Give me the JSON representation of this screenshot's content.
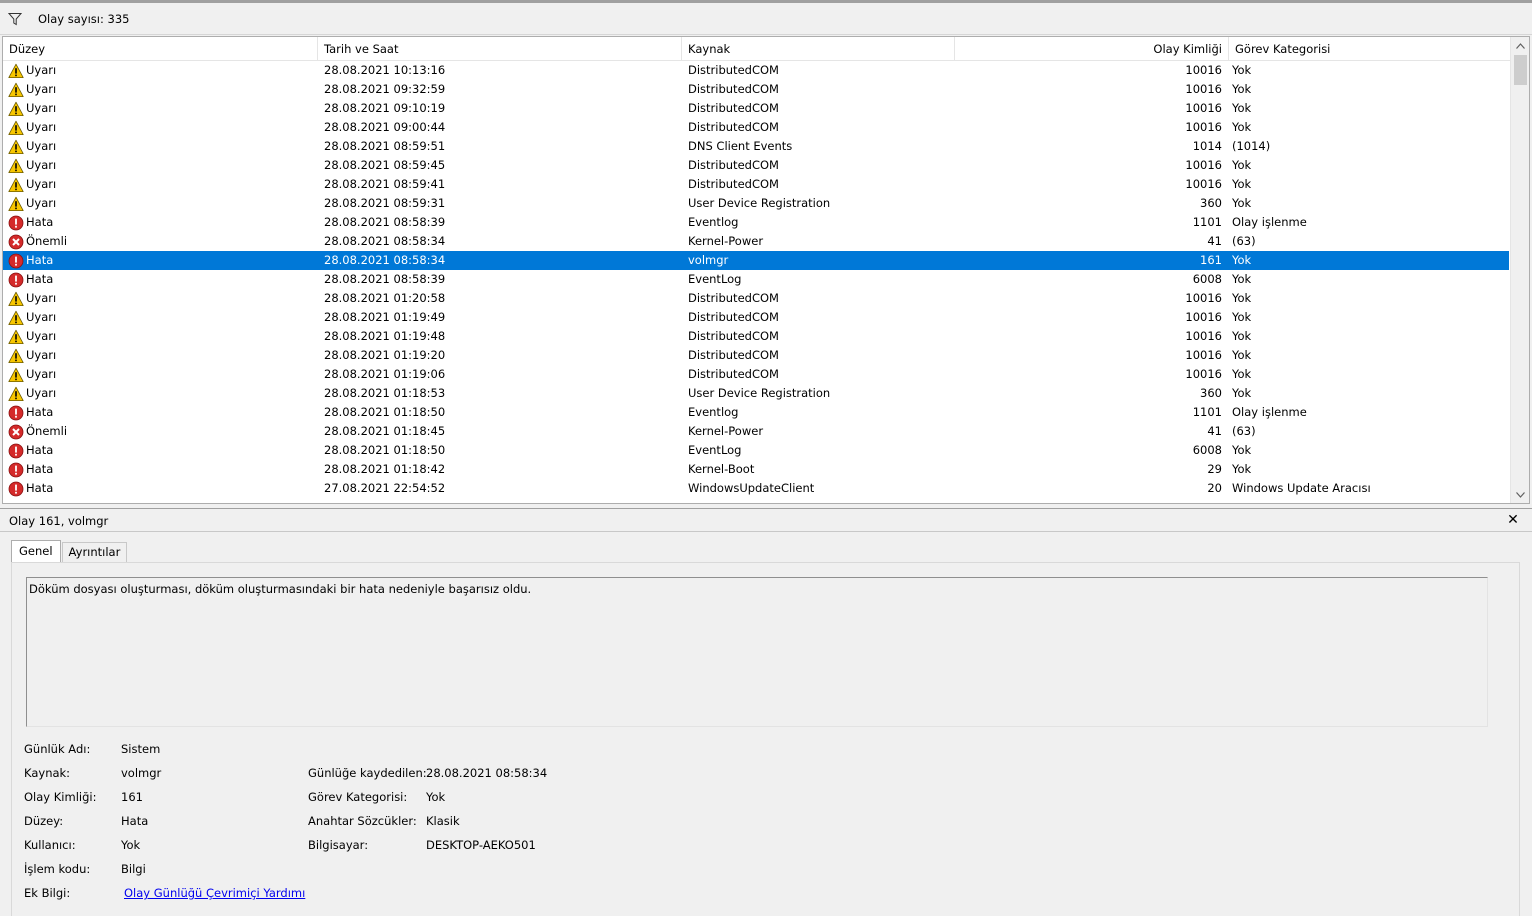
{
  "toolbar": {
    "filter_icon": "filter-funnel-icon",
    "event_count": "Olay sayısı: 335"
  },
  "columns": {
    "level": "Düzey",
    "date": "Tarih ve Saat",
    "source": "Kaynak",
    "id": "Olay Kimliği",
    "task": "Görev Kategorisi"
  },
  "level_colors": {
    "warning": "#f5c400",
    "error": "#cc1f1f",
    "critical": "#cc1f1f",
    "selected_bg": "#0078d7"
  },
  "events": [
    {
      "type": "warning",
      "level": "Uyarı",
      "date": "28.08.2021 10:13:16",
      "source": "DistributedCOM",
      "id": "10016",
      "task": "Yok"
    },
    {
      "type": "warning",
      "level": "Uyarı",
      "date": "28.08.2021 09:32:59",
      "source": "DistributedCOM",
      "id": "10016",
      "task": "Yok"
    },
    {
      "type": "warning",
      "level": "Uyarı",
      "date": "28.08.2021 09:10:19",
      "source": "DistributedCOM",
      "id": "10016",
      "task": "Yok"
    },
    {
      "type": "warning",
      "level": "Uyarı",
      "date": "28.08.2021 09:00:44",
      "source": "DistributedCOM",
      "id": "10016",
      "task": "Yok"
    },
    {
      "type": "warning",
      "level": "Uyarı",
      "date": "28.08.2021 08:59:51",
      "source": "DNS Client Events",
      "id": "1014",
      "task": "(1014)"
    },
    {
      "type": "warning",
      "level": "Uyarı",
      "date": "28.08.2021 08:59:45",
      "source": "DistributedCOM",
      "id": "10016",
      "task": "Yok"
    },
    {
      "type": "warning",
      "level": "Uyarı",
      "date": "28.08.2021 08:59:41",
      "source": "DistributedCOM",
      "id": "10016",
      "task": "Yok"
    },
    {
      "type": "warning",
      "level": "Uyarı",
      "date": "28.08.2021 08:59:31",
      "source": "User Device Registration",
      "id": "360",
      "task": "Yok"
    },
    {
      "type": "error",
      "level": "Hata",
      "date": "28.08.2021 08:58:39",
      "source": "Eventlog",
      "id": "1101",
      "task": "Olay işlenme"
    },
    {
      "type": "critical",
      "level": "Önemli",
      "date": "28.08.2021 08:58:34",
      "source": "Kernel-Power",
      "id": "41",
      "task": "(63)"
    },
    {
      "type": "error",
      "level": "Hata",
      "date": "28.08.2021 08:58:34",
      "source": "volmgr",
      "id": "161",
      "task": "Yok",
      "selected": true
    },
    {
      "type": "error",
      "level": "Hata",
      "date": "28.08.2021 08:58:39",
      "source": "EventLog",
      "id": "6008",
      "task": "Yok"
    },
    {
      "type": "warning",
      "level": "Uyarı",
      "date": "28.08.2021 01:20:58",
      "source": "DistributedCOM",
      "id": "10016",
      "task": "Yok"
    },
    {
      "type": "warning",
      "level": "Uyarı",
      "date": "28.08.2021 01:19:49",
      "source": "DistributedCOM",
      "id": "10016",
      "task": "Yok"
    },
    {
      "type": "warning",
      "level": "Uyarı",
      "date": "28.08.2021 01:19:48",
      "source": "DistributedCOM",
      "id": "10016",
      "task": "Yok"
    },
    {
      "type": "warning",
      "level": "Uyarı",
      "date": "28.08.2021 01:19:20",
      "source": "DistributedCOM",
      "id": "10016",
      "task": "Yok"
    },
    {
      "type": "warning",
      "level": "Uyarı",
      "date": "28.08.2021 01:19:06",
      "source": "DistributedCOM",
      "id": "10016",
      "task": "Yok"
    },
    {
      "type": "warning",
      "level": "Uyarı",
      "date": "28.08.2021 01:18:53",
      "source": "User Device Registration",
      "id": "360",
      "task": "Yok"
    },
    {
      "type": "error",
      "level": "Hata",
      "date": "28.08.2021 01:18:50",
      "source": "Eventlog",
      "id": "1101",
      "task": "Olay işlenme"
    },
    {
      "type": "critical",
      "level": "Önemli",
      "date": "28.08.2021 01:18:45",
      "source": "Kernel-Power",
      "id": "41",
      "task": "(63)"
    },
    {
      "type": "error",
      "level": "Hata",
      "date": "28.08.2021 01:18:50",
      "source": "EventLog",
      "id": "6008",
      "task": "Yok"
    },
    {
      "type": "error",
      "level": "Hata",
      "date": "28.08.2021 01:18:42",
      "source": "Kernel-Boot",
      "id": "29",
      "task": "Yok"
    },
    {
      "type": "error",
      "level": "Hata",
      "date": "27.08.2021 22:54:52",
      "source": "WindowsUpdateClient",
      "id": "20",
      "task": "Windows Update Aracısı"
    }
  ],
  "detail": {
    "title": "Olay 161, volmgr",
    "close_icon": "close-icon",
    "tabs": [
      "Genel",
      "Ayrıntılar"
    ],
    "description": "Döküm dosyası oluşturması, döküm oluşturmasındaki bir hata nedeniyle başarısız oldu.",
    "props": {
      "log_name_label": "Günlük Adı:",
      "log_name": "Sistem",
      "source_label": "Kaynak:",
      "source": "volmgr",
      "logged_label": "Günlüğe kaydedilen:",
      "logged": "28.08.2021 08:58:34",
      "event_id_label": "Olay Kimliği:",
      "event_id": "161",
      "task_label": "Görev Kategorisi:",
      "task": "Yok",
      "level_label": "Düzey:",
      "level": "Hata",
      "keywords_label": "Anahtar Sözcükler:",
      "keywords": "Klasik",
      "user_label": "Kullanıcı:",
      "user": "Yok",
      "computer_label": "Bilgisayar:",
      "computer": "DESKTOP-AEKO501",
      "opcode_label": "İşlem kodu:",
      "opcode": "Bilgi",
      "more_info_label": "Ek Bilgi:",
      "more_info_link": "Olay Günlüğü Çevrimiçi Yardımı"
    }
  }
}
